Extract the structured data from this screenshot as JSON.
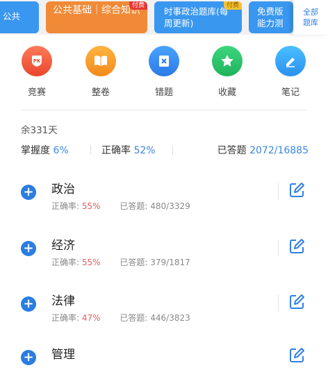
{
  "tabs": [
    {
      "label": "公共",
      "badge": ""
    },
    {
      "label": "公共基础｜综合知识",
      "badge": "付费"
    },
    {
      "label": "时事政治题库(每周更新)",
      "badge": "付费"
    },
    {
      "label": "免费版能力测",
      "badge": ""
    }
  ],
  "all_tab": {
    "label": "全部题库"
  },
  "tools": [
    {
      "label": "竞赛",
      "icon": "pk-icon"
    },
    {
      "label": "整卷",
      "icon": "book-icon"
    },
    {
      "label": "错题",
      "icon": "wrong-note-icon"
    },
    {
      "label": "收藏",
      "icon": "star-icon"
    },
    {
      "label": "笔记",
      "icon": "pen-icon"
    }
  ],
  "summary": {
    "days_left": "余331天",
    "mastery_label": "掌握度",
    "mastery_value": "6%",
    "accuracy_label": "正确率",
    "accuracy_value": "52%",
    "answered_label": "已答题",
    "answered_value": "2072/16885"
  },
  "subjects": [
    {
      "name": "政治",
      "rate_label": "正确率:",
      "rate": "55%",
      "answered_label": "已答题:",
      "answered": "480/3329"
    },
    {
      "name": "经济",
      "rate_label": "正确率:",
      "rate": "55%",
      "answered_label": "已答题:",
      "answered": "379/1817"
    },
    {
      "name": "法律",
      "rate_label": "正确率:",
      "rate": "47%",
      "answered_label": "已答题:",
      "answered": "446/3823"
    },
    {
      "name": "管理",
      "rate_label": "",
      "rate": "",
      "answered_label": "",
      "answered": ""
    }
  ],
  "colors": {
    "accent": "#3a86e3",
    "tab_active": "#f08a36",
    "rate": "#e35d5d"
  }
}
